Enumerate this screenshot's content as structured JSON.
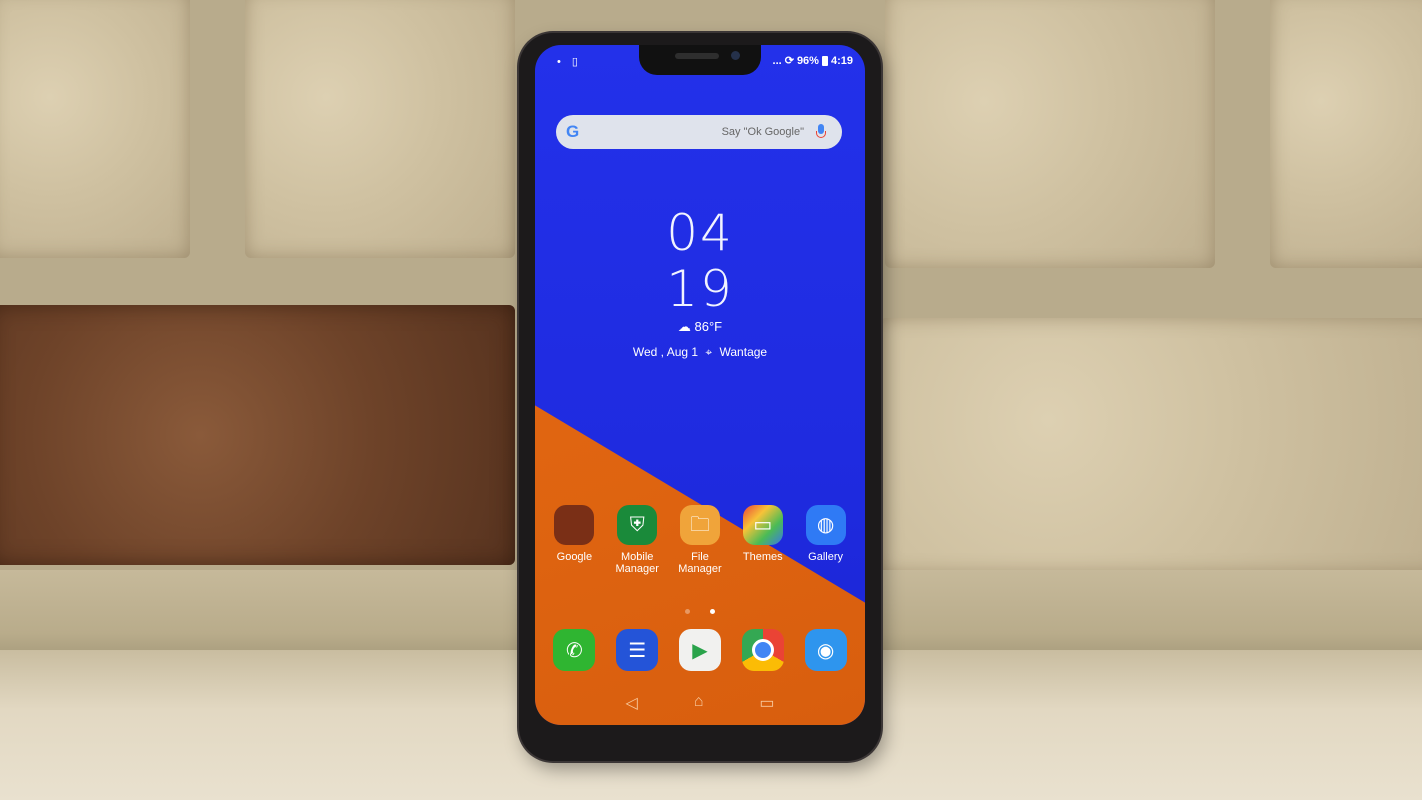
{
  "scene": {
    "description": "Smartphone leaning against a brick wall showing its Android home screen",
    "colors": {
      "wallpaper_blue": "#2331ea",
      "wallpaper_orange": "#e26612",
      "phone_body": "#1c1a1b"
    }
  },
  "status_bar": {
    "left_icons": [
      "notification-dot-icon",
      "sd-card-icon"
    ],
    "overflow": "...",
    "sync_icon": "sync-icon",
    "battery_percent": "96%",
    "time": "4:19"
  },
  "search": {
    "logo": "G",
    "hint": "Say \"Ok Google\""
  },
  "clock": {
    "hour": "04",
    "minute": "19"
  },
  "weather": {
    "icon": "partly-cloudy-icon",
    "temperature": "86°F"
  },
  "date": "Wed , Aug 1",
  "location": "Wantage",
  "apps": [
    {
      "label": "Google",
      "icon": "google-folder-icon"
    },
    {
      "label": "Mobile\nManager",
      "icon": "shield-gauge-icon"
    },
    {
      "label": "File\nManager",
      "icon": "folder-icon"
    },
    {
      "label": "Themes",
      "icon": "paint-roller-icon"
    },
    {
      "label": "Gallery",
      "icon": "balloon-icon"
    }
  ],
  "page_indicator": {
    "pages": 2,
    "current": 2
  },
  "dock": [
    {
      "name": "Phone",
      "icon": "phone-icon"
    },
    {
      "name": "Messages",
      "icon": "message-icon"
    },
    {
      "name": "Play Store",
      "icon": "play-store-icon"
    },
    {
      "name": "Chrome",
      "icon": "chrome-icon"
    },
    {
      "name": "Camera",
      "icon": "camera-icon"
    }
  ],
  "navbar": {
    "back": "◁",
    "home": "⌂",
    "recents": "▭"
  }
}
